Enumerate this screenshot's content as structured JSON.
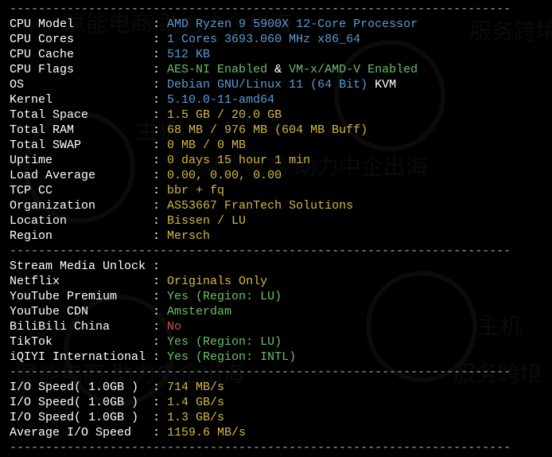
{
  "divider": "----------------------------------------------------------------------",
  "sections": {
    "system": [
      {
        "label": "CPU Model",
        "value": "AMD Ryzen 9 5900X 12-Core Processor",
        "class": "blue"
      },
      {
        "label": "CPU Cores",
        "value": "1 Cores 3693.060 MHz x86_64",
        "class": "blue"
      },
      {
        "label": "CPU Cache",
        "value": "512 KB",
        "class": "blue"
      },
      {
        "label": "CPU Flags",
        "parts": [
          {
            "text": "AES-NI Enabled",
            "class": "green"
          },
          {
            "text": " & ",
            "class": "white"
          },
          {
            "text": "VM-x/AMD-V Enabled",
            "class": "green"
          }
        ]
      },
      {
        "label": "OS",
        "parts": [
          {
            "text": "Debian GNU/Linux 11 (64 Bit)",
            "class": "blue"
          },
          {
            "text": " KVM",
            "class": "white"
          }
        ]
      },
      {
        "label": "Kernel",
        "value": "5.10.0-11-amd64",
        "class": "blue"
      },
      {
        "label": "Total Space",
        "value": "1.5 GB / 20.0 GB",
        "class": "yellow"
      },
      {
        "label": "Total RAM",
        "value": "68 MB / 976 MB (604 MB Buff)",
        "class": "yellow"
      },
      {
        "label": "Total SWAP",
        "value": "0 MB / 0 MB",
        "class": "yellow"
      },
      {
        "label": "Uptime",
        "value": "0 days 15 hour 1 min",
        "class": "yellow"
      },
      {
        "label": "Load Average",
        "value": "0.00, 0.00, 0.00",
        "class": "yellow"
      },
      {
        "label": "TCP CC",
        "value": "bbr + fq",
        "class": "yellow"
      },
      {
        "label": "Organization",
        "value": "AS53667 FranTech Solutions",
        "class": "yellow"
      },
      {
        "label": "Location",
        "value": "Bissen / LU",
        "class": "yellow"
      },
      {
        "label": "Region",
        "value": "Mersch",
        "class": "yellow"
      }
    ],
    "stream_header": {
      "label": "Stream Media Unlock",
      "value": ""
    },
    "stream": [
      {
        "label": "Netflix",
        "value": "Originals Only",
        "class": "yellow"
      },
      {
        "label": "YouTube Premium",
        "value": "Yes (Region: LU)",
        "class": "green"
      },
      {
        "label": "YouTube CDN",
        "value": "Amsterdam",
        "class": "green"
      },
      {
        "label": "BiliBili China",
        "value": "No",
        "class": "red"
      },
      {
        "label": "TikTok",
        "value": "Yes (Region: LU)",
        "class": "green"
      },
      {
        "label": "iQIYI International",
        "value": "Yes (Region: INTL)",
        "class": "green"
      }
    ],
    "io": [
      {
        "label": "I/O Speed( 1.0GB )",
        "value": "714 MB/s",
        "class": "yellow"
      },
      {
        "label": "I/O Speed( 1.0GB )",
        "value": "1.4 GB/s",
        "class": "yellow"
      },
      {
        "label": "I/O Speed( 1.0GB )",
        "value": "1.3 GB/s",
        "class": "yellow"
      },
      {
        "label": "Average I/O Speed",
        "value": "1159.6 MB/s",
        "class": "yellow"
      }
    ]
  },
  "watermark": {
    "text1": "赋能电商 助力中企出海",
    "text2": "服务跨境",
    "text3": "主机"
  }
}
